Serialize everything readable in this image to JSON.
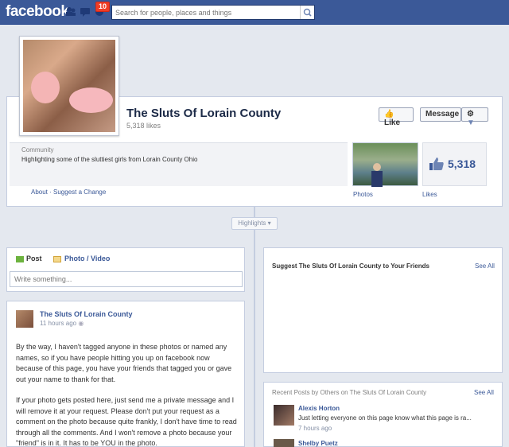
{
  "topbar": {
    "logo": "facebook",
    "notifications_badge": "10",
    "search_placeholder": "Search for people, places and things"
  },
  "page": {
    "name": "The Sluts Of Lorain County",
    "likes_subtext": "5,318 likes",
    "buttons": {
      "like": "Like",
      "message": "Message"
    },
    "category": "Community",
    "about_text": "Highlighting some of the sluttiest girls from Lorain County Ohio",
    "about_links": {
      "about": "About",
      "separator": " · ",
      "suggest": "Suggest a Change"
    },
    "photos_label": "Photos",
    "likes_count": "5,318",
    "likes_label": "Likes",
    "highlights": "Highlights"
  },
  "composer": {
    "tab_post": "Post",
    "tab_photo": "Photo / Video",
    "placeholder": "Write something..."
  },
  "suggest": {
    "title": "Suggest The Sluts Of Lorain County to Your Friends",
    "see_all": "See All"
  },
  "post": {
    "author": "The Sluts Of Lorain County",
    "time": "11 hours ago",
    "paragraph1": "By the way, I haven't tagged anyone in these photos or named any names, so if you have people hitting you up on facebook now because of this page, you have your friends that tagged you or gave out your name to thank for that.",
    "paragraph2": "If your photo gets posted here, just send me a private message and I will remove it at your request. Please don't put your request as a comment on the photo because quite frankly, I don't have time to read through all the comments. And I won't remove a photo because your \"friend\" is in it. It has to be YOU in the photo."
  },
  "recent": {
    "title": "Recent Posts by Others on The Sluts Of Lorain County",
    "see_all": "See All",
    "items": [
      {
        "name": "Alexis Horton",
        "text": "Just letting everyone on this page know what this page is ra...",
        "time": "7 hours ago"
      },
      {
        "name": "Shelby Puetz"
      }
    ]
  },
  "colors": {
    "brand": "#3b5998",
    "background": "#e4e8ef",
    "badge": "#f03d25"
  }
}
